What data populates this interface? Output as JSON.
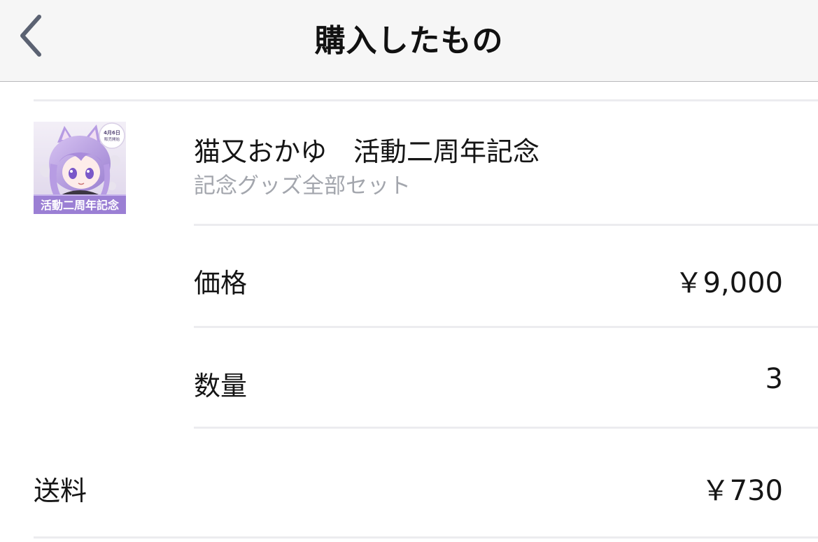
{
  "navbar": {
    "title": "購入したもの",
    "back_icon": "chevron-left-icon"
  },
  "product": {
    "name": "猫又おかゆ　活動二周年記念",
    "subtitle": "記念グッズ全部セット",
    "thumbnail": {
      "badge_text": "4月6日 販売開始",
      "banner_text": "活動二周年記念"
    }
  },
  "price": {
    "label": "価格",
    "value": "￥9,000"
  },
  "quantity": {
    "label": "数量",
    "value": "3"
  },
  "shipping": {
    "label": "送料",
    "value": "￥730"
  },
  "colors": {
    "accent_purple": "#9b7fd4",
    "subtitle_gray": "#a3a6ad",
    "back_icon": "#5b6272"
  }
}
